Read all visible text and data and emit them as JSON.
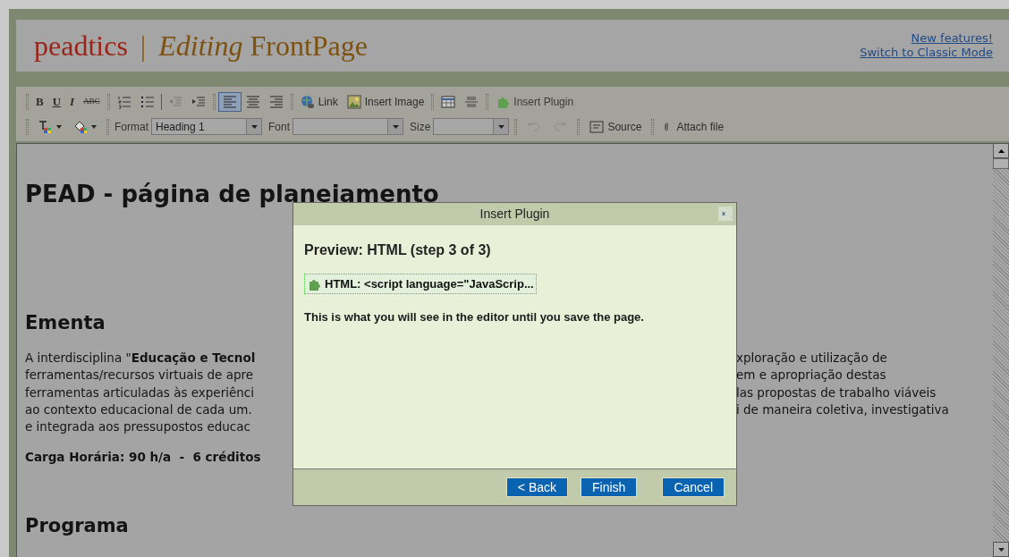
{
  "header": {
    "site": "peadtics",
    "separator": "|",
    "action": "Editing",
    "page": "FrontPage",
    "links": [
      {
        "label": "New features!"
      },
      {
        "label": "Switch to Classic Mode"
      }
    ]
  },
  "toolbar": {
    "bold": "B",
    "underline": "U",
    "italic": "I",
    "strike": "ABC",
    "link": "Link",
    "insert_image": "Insert Image",
    "insert_plugin": "Insert Plugin",
    "alignment": [
      {
        "selected": true
      },
      {
        "selected": false
      },
      {
        "selected": false
      }
    ],
    "format_label": "Format",
    "format_value": "Heading 1",
    "font_label": "Font",
    "size_label": "Size",
    "source": "Source",
    "attach_file": "Attach file"
  },
  "editor": {
    "title": "PEAD - página de planejamento",
    "sections": [
      {
        "heading": "Ementa",
        "lines": [
          {
            "left": "A interdisciplina \"**Educação e Tecnol**",
            "right": "xploração e utilização de"
          },
          {
            "left": "ferramentas/recursos virtuais de apre",
            "right": "em e apropriação destas"
          },
          {
            "left": "ferramentas articuladas às experiênci",
            "right": "las propostas de trabalho viáveis"
          },
          {
            "left": "ao contexto educacional de cada um.",
            "right": "i de maneira coletiva, investigativa"
          },
          {
            "left": "e integrada aos pressupostos educac"
          }
        ],
        "note": "Carga Horária: 90 h/a  -  6 créditos"
      },
      {
        "heading": "Programa"
      }
    ]
  },
  "dialog": {
    "title": "Insert Plugin",
    "heading": "Preview: HTML (step 3 of 3)",
    "plugin": "HTML: <script language=\"JavaScrip...",
    "message": "This is what you will see in the editor until you save the page.",
    "buttons": [
      "< Back",
      "Finish",
      "Cancel"
    ]
  }
}
